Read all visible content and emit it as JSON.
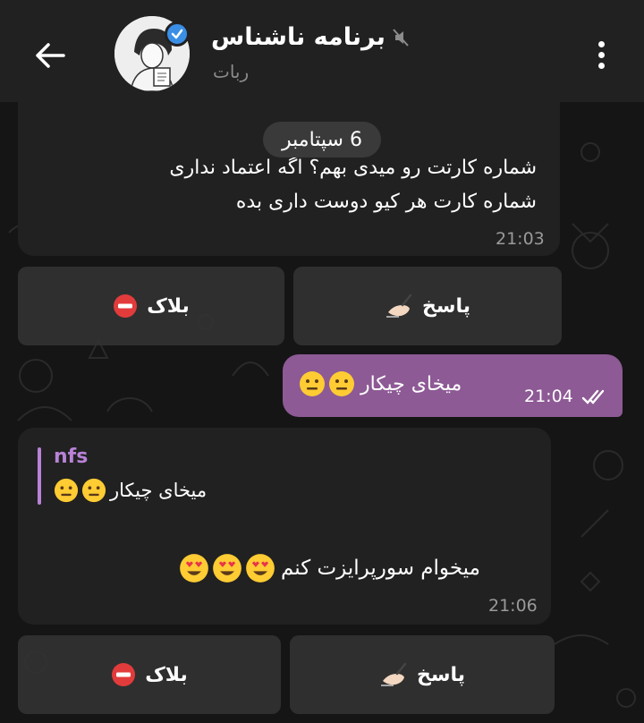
{
  "header": {
    "title": "برنامه ناشناس",
    "subtitle": "ربات",
    "icons": {
      "back": "back-arrow-icon",
      "mute": "mute-icon",
      "verified": "verified-badge-icon",
      "menu": "more-vert-icon"
    }
  },
  "date_separator": "6 سپتامبر",
  "messages": [
    {
      "direction": "incoming",
      "lines": [
        "شماره کارتت رو میدی بهم؟ اگه اعتماد نداری",
        "شماره کارت هر کیو دوست داری بده"
      ],
      "time": "21:03"
    },
    {
      "direction": "outgoing",
      "text": "میخای چیکار",
      "emoji": [
        "neutral-face",
        "neutral-face"
      ],
      "time": "21:04",
      "status": "read-double-check"
    },
    {
      "direction": "incoming",
      "reply_to": {
        "name": "nfs",
        "text": "میخای چیکار",
        "emoji": [
          "neutral-face",
          "neutral-face"
        ]
      },
      "text": "میخوام سورپرایزت کنم",
      "emoji": [
        "heart-eyes-face",
        "heart-eyes-face",
        "heart-eyes-face"
      ],
      "time": "21:06"
    }
  ],
  "keyboards": [
    {
      "reply_label": "پاسخ",
      "reply_icon": "writing-hand-icon",
      "block_label": "بلاک",
      "block_icon": "no-entry-icon"
    },
    {
      "reply_label": "پاسخ",
      "reply_icon": "writing-hand-icon",
      "block_label": "بلاک",
      "block_icon": "no-entry-icon"
    }
  ],
  "colors": {
    "header_bg": "#212121",
    "incoming_bubble": "#212121",
    "outgoing_bubble": "#8d5a95",
    "accent_name": "#b882d6"
  }
}
